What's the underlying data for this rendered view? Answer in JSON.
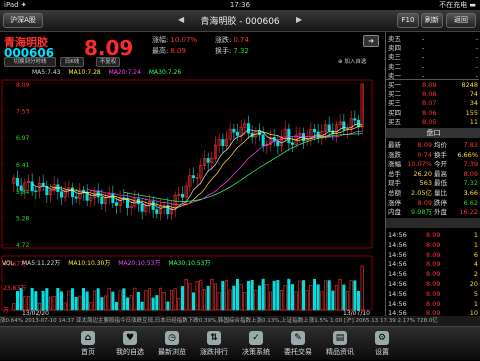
{
  "status": {
    "left": "iPad ✦",
    "time": "17:36",
    "right": "不在充电 ▬"
  },
  "topbar": {
    "market_btn": "沪深A股",
    "title": "青海明胶 - 000606",
    "f10": "F10",
    "refresh": "刷新",
    "back": "返回"
  },
  "stock": {
    "name": "青海明胶",
    "code": "000606",
    "price": "8.09",
    "info": [
      {
        "k": "涨幅:",
        "v": "10.07%",
        "c": "red"
      },
      {
        "k": "最高:",
        "v": "8.09",
        "c": "red"
      },
      {
        "k": "涨跌:",
        "v": "0.74",
        "c": "red"
      },
      {
        "k": "换手:",
        "v": "7.32",
        "c": "green"
      }
    ],
    "add": "加入自选"
  },
  "controls": {
    "period_switch": "切换到分时线",
    "period": "日K线",
    "adjust": "不复权"
  },
  "ma": [
    {
      "label": "MA5:7.43",
      "color": "#dddddd"
    },
    {
      "label": "MA10:7.28",
      "color": "#ffee33"
    },
    {
      "label": "MA20:7.24",
      "color": "#ff44ff"
    },
    {
      "label": "MA30:7.26",
      "color": "#33ff66"
    }
  ],
  "yaxis": [
    "8.09",
    "7.53",
    "6.97",
    "6.41",
    "5.84",
    "5.28",
    "4.72"
  ],
  "vol": {
    "label": "VOL",
    "ma": [
      {
        "label": "MA5:11.22万",
        "color": "#dddddd"
      },
      {
        "label": "MA10:10.30万",
        "color": "#ffee33"
      },
      {
        "label": "MA20:10.53万",
        "color": "#ff44ff"
      },
      {
        "label": "MA30:10.53万",
        "color": "#33ff66"
      }
    ],
    "yaxis": [
      "47.67万",
      "23.83万",
      "万"
    ],
    "dates": [
      "13/02/20",
      "13/07/10"
    ]
  },
  "orderbook": {
    "sells": [
      {
        "label": "卖五",
        "p": "-",
        "v": "-"
      },
      {
        "label": "卖四",
        "p": "-",
        "v": "-"
      },
      {
        "label": "卖三",
        "p": "-",
        "v": "-"
      },
      {
        "label": "卖二",
        "p": "-",
        "v": "-"
      },
      {
        "label": "卖一",
        "p": "-",
        "v": "-"
      }
    ],
    "buys": [
      {
        "label": "买一",
        "p": "8.09",
        "v": "8248"
      },
      {
        "label": "买二",
        "p": "8.08",
        "v": "74"
      },
      {
        "label": "买三",
        "p": "8.07",
        "v": "34"
      },
      {
        "label": "买四",
        "p": "8.06",
        "v": "155"
      },
      {
        "label": "买五",
        "p": "8.05",
        "v": "11"
      }
    ]
  },
  "panel_title": "盘口",
  "stats": [
    {
      "k1": "最新",
      "v1": "8.09",
      "c1": "red",
      "k2": "均价",
      "v2": "7.83",
      "c2": "red"
    },
    {
      "k1": "涨跌",
      "v1": "0.74",
      "c1": "red",
      "k2": "换手",
      "v2": "6.66%",
      "c2": "yel"
    },
    {
      "k1": "涨幅",
      "v1": "10.07%",
      "c1": "red",
      "k2": "今开",
      "v2": "7.39",
      "c2": "red"
    },
    {
      "k1": "总手",
      "v1": "26.20",
      "c1": "yel",
      "k2": "最高",
      "v2": "8.09",
      "c2": "red"
    },
    {
      "k1": "现手",
      "v1": "563",
      "c1": "yel",
      "k2": "最低",
      "v2": "7.32",
      "c2": "green"
    },
    {
      "k1": "总额",
      "v1": "2.05亿",
      "c1": "yel",
      "k2": "量比",
      "v2": "3.66",
      "c2": "yel"
    },
    {
      "k1": "涨停",
      "v1": "8.09",
      "c1": "red",
      "k2": "跌停",
      "v2": "6.62",
      "c2": "green"
    },
    {
      "k1": "内盘",
      "v1": "9.98万",
      "c1": "green",
      "k2": "外盘",
      "v2": "16.22",
      "c2": "red"
    }
  ],
  "trades": [
    {
      "t": "14:56",
      "p": "8.09",
      "v": "1"
    },
    {
      "t": "14:56",
      "p": "8.09",
      "v": "1"
    },
    {
      "t": "14:56",
      "p": "8.09",
      "v": "6"
    },
    {
      "t": "14:56",
      "p": "8.09",
      "v": "4"
    },
    {
      "t": "14:56",
      "p": "8.09",
      "v": "2"
    },
    {
      "t": "14:56",
      "p": "8.09",
      "v": "20"
    },
    {
      "t": "14:56",
      "p": "8.09",
      "v": "5"
    },
    {
      "t": "14:56",
      "p": "8.09",
      "v": "1"
    },
    {
      "t": "14:56",
      "p": "8.09",
      "v": "10"
    },
    {
      "t": "14:56",
      "p": "8.09",
      "v": "74"
    },
    {
      "t": "14:56",
      "p": "8.09",
      "v": "68"
    },
    {
      "t": "14:56",
      "p": "8.09",
      "v": "1"
    },
    {
      "t": "15:00",
      "p": "8.09",
      "v": "563"
    }
  ],
  "ticker": "涨0.64%    2013-07-10 14:37 亚太周边主要股指今日涨跌互现,日本日经指数下跌0.39%,韩国综合指数上涨0.13%,上证指数上涨1.5%    1.00    [沪]    2065.13    17.39    2.17%    728.0亿",
  "nav": [
    {
      "label": "首页",
      "icon": "⌂"
    },
    {
      "label": "我的自选",
      "icon": "♥"
    },
    {
      "label": "最新浏览",
      "icon": "◷"
    },
    {
      "label": "涨跌排行",
      "icon": "⇅"
    },
    {
      "label": "决策系统",
      "icon": "✓"
    },
    {
      "label": "委托交易",
      "icon": "✎"
    },
    {
      "label": "精品资讯",
      "icon": "▤"
    },
    {
      "label": "设置",
      "icon": "⚙"
    }
  ]
}
